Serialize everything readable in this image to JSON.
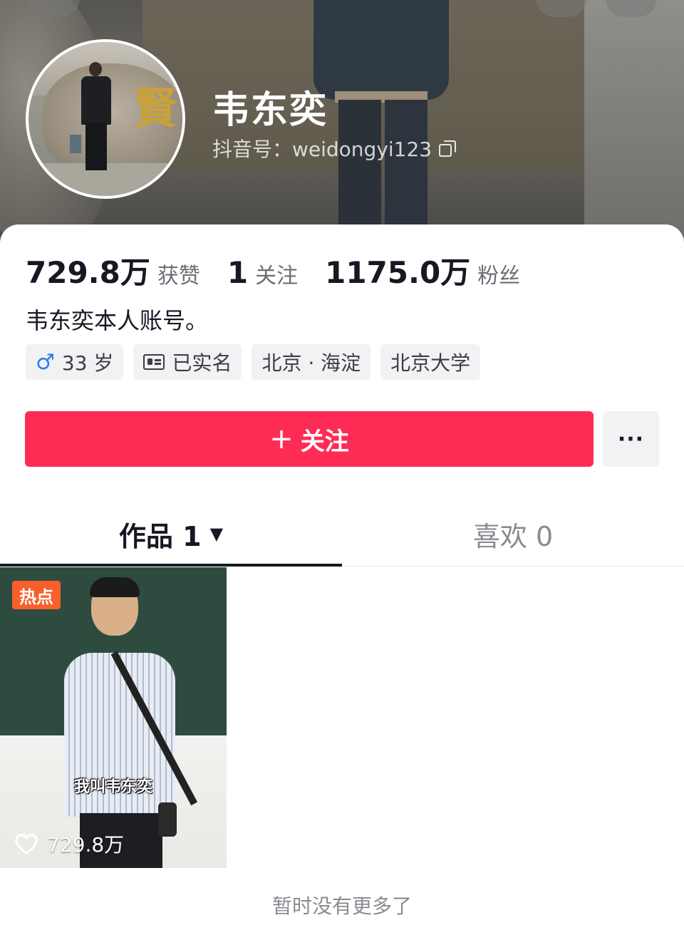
{
  "profile": {
    "name": "韦东奕",
    "douyin_id": "抖音号：weidongyi123",
    "avatar_char": "賢"
  },
  "stats": [
    {
      "value": "729.8万",
      "label": "获赞"
    },
    {
      "value": "1",
      "label": "关注"
    },
    {
      "value": "1175.0万",
      "label": "粉丝"
    }
  ],
  "bio": "韦东奕本人账号。",
  "tags": {
    "age": "33 岁",
    "verified": "已实名",
    "location": "北京 · 海淀",
    "school": "北京大学"
  },
  "actions": {
    "follow_label": "关注",
    "more_label": "···",
    "follow_color": "#fe2c55"
  },
  "tabs": {
    "works_label": "作品 1",
    "works_caret": "▼",
    "likes_label": "喜欢 0"
  },
  "video": {
    "badge": "热点",
    "subtitle": "我叫韦东奕",
    "likes": "729.8万",
    "badge_color": "#f85f2b"
  },
  "footer": {
    "no_more": "暂时没有更多了"
  }
}
